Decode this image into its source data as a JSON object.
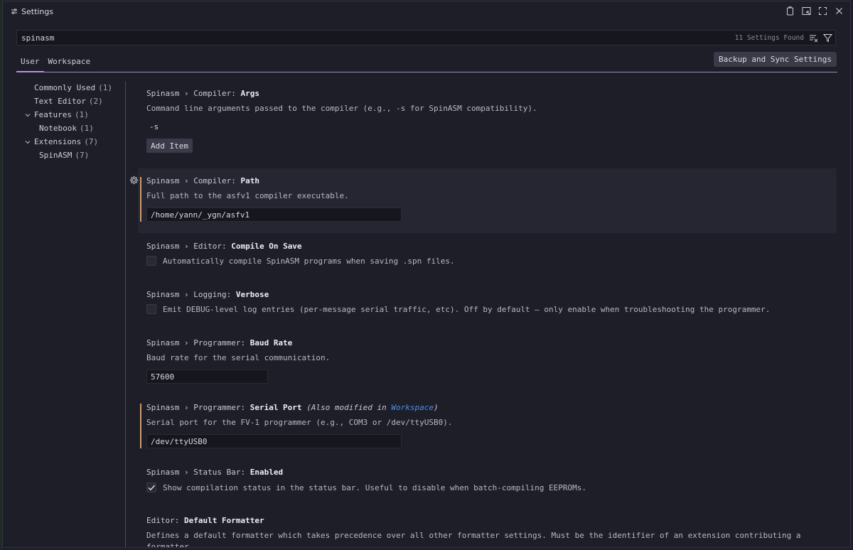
{
  "window": {
    "title": "Settings"
  },
  "search": {
    "value": "spinasm",
    "found": "11 Settings Found"
  },
  "tabs": [
    {
      "label": "User"
    },
    {
      "label": "Workspace"
    }
  ],
  "sync_button": "Backup and Sync Settings",
  "toc": [
    {
      "label": "Commonly Used",
      "count": "(1)"
    },
    {
      "label": "Text Editor",
      "count": "(2)"
    },
    {
      "label": "Features",
      "count": "(1)"
    },
    {
      "label": "Notebook",
      "count": "(1)"
    },
    {
      "label": "Extensions",
      "count": "(7)"
    },
    {
      "label": "SpinASM",
      "count": "(7)"
    }
  ],
  "settings": {
    "args": {
      "prefix": "Spinasm › Compiler: ",
      "name": "Args",
      "desc": "Command line arguments passed to the compiler (e.g., -s for SpinASM compatibility).",
      "item": "-s",
      "add": "Add Item"
    },
    "path": {
      "prefix": "Spinasm › Compiler: ",
      "name": "Path",
      "desc": "Full path to the asfv1 compiler executable.",
      "value": "/home/yann/_ygn/asfv1"
    },
    "compile": {
      "prefix": "Spinasm › Editor: ",
      "name": "Compile On Save",
      "label": "Automatically compile SpinASM programs when saving .spn files."
    },
    "verbose": {
      "prefix": "Spinasm › Logging: ",
      "name": "Verbose",
      "label": "Emit DEBUG-level log entries (per-message serial traffic, etc). Off by default — only enable when troubleshooting the programmer."
    },
    "baud": {
      "prefix": "Spinasm › Programmer: ",
      "name": "Baud Rate",
      "desc": "Baud rate for the serial communication.",
      "value": "57600"
    },
    "serial": {
      "prefix": "Spinasm › Programmer: ",
      "name": "Serial Port",
      "modified_pre": "(Also modified in ",
      "modified_link": "Workspace",
      "modified_post": ")",
      "desc": "Serial port for the FV-1 programmer (e.g., COM3 or /dev/ttyUSB0).",
      "value": "/dev/ttyUSB0"
    },
    "statusbar": {
      "prefix": "Spinasm › Status Bar: ",
      "name": "Enabled",
      "label": "Show compilation status in the status bar. Useful to disable when batch-compiling EEPROMs."
    },
    "formatter": {
      "prefix": "Editor: ",
      "name": "Default Formatter",
      "desc": "Defines a default formatter which takes precedence over all other formatter settings. Must be the identifier of an extension contributing a",
      "desc2": "formatter."
    }
  }
}
